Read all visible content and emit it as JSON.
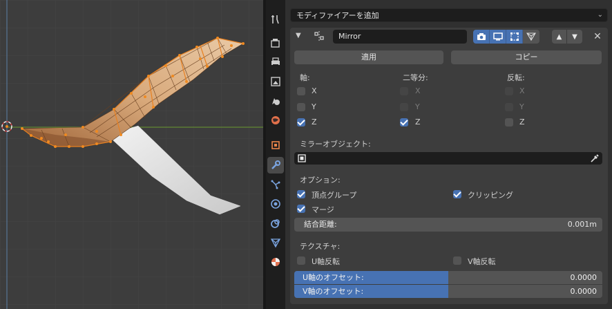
{
  "add_modifier": {
    "label": "モディファイアーを追加"
  },
  "modifier": {
    "name": "Mirror",
    "apply_label": "適用",
    "copy_label": "コピー",
    "axis_header": "軸:",
    "bisect_header": "二等分:",
    "flip_header": "反転:",
    "axis": [
      {
        "label": "X",
        "checked": false
      },
      {
        "label": "Y",
        "checked": false
      },
      {
        "label": "Z",
        "checked": true
      }
    ],
    "bisect": [
      {
        "label": "X",
        "checked": false
      },
      {
        "label": "Y",
        "checked": false
      },
      {
        "label": "Z",
        "checked": true
      }
    ],
    "flip": [
      {
        "label": "X",
        "checked": false
      },
      {
        "label": "Y",
        "checked": false
      },
      {
        "label": "Z",
        "checked": false
      }
    ],
    "mirror_object_label": "ミラーオブジェクト:",
    "options_label": "オプション:",
    "vertex_groups_label": "頂点グループ",
    "clipping_label": "クリッピング",
    "merge_label": "マージ",
    "merge_distance_label": "結合距離:",
    "merge_distance_value": "0.001m",
    "textures_label": "テクスチャ:",
    "flip_u_label": "U軸反転",
    "flip_v_label": "V軸反転",
    "u_offset_label": "U軸のオフセット:",
    "u_offset_value": "0.0000",
    "v_offset_label": "V軸のオフセット:",
    "v_offset_value": "0.0000"
  },
  "icons": {
    "tabs": [
      "tool-icon",
      "render-icon",
      "output-icon",
      "view-layer-icon",
      "scene-icon",
      "world-icon",
      "object-icon",
      "modifier-icon",
      "particles-icon",
      "physics-icon",
      "constraints-icon",
      "data-icon",
      "material-icon"
    ]
  },
  "colors": {
    "accent": "#4772b3",
    "vertex": "#f08a20",
    "panel": "#303030"
  }
}
